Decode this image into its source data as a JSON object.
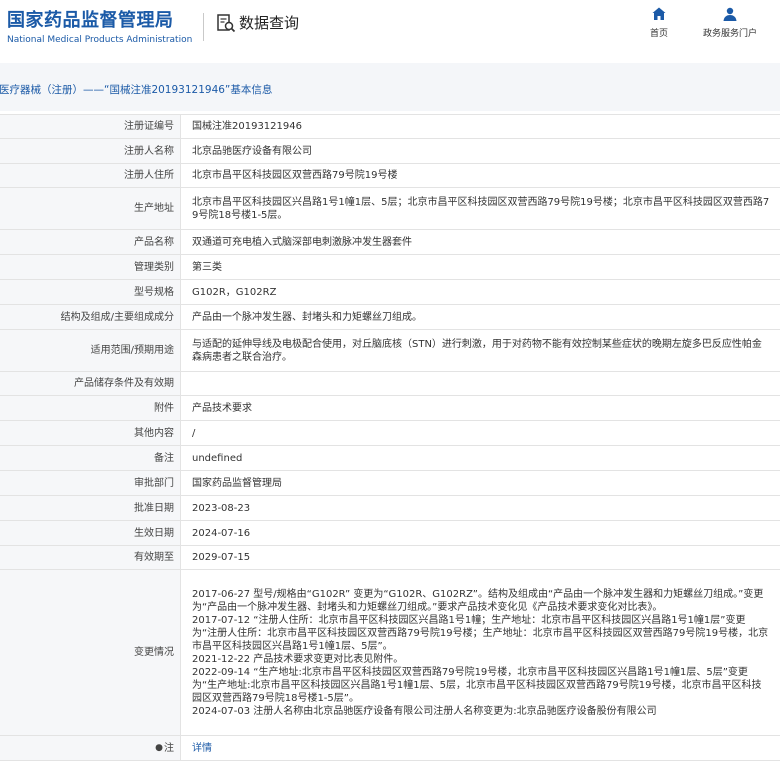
{
  "header": {
    "logo_cn": "国家药品监督管理局",
    "logo_en": "National Medical Products Administration",
    "section_title": "数据查询",
    "nav": [
      {
        "label": "首页",
        "icon": "home-icon"
      },
      {
        "label": "政务服务门户",
        "icon": "user-icon"
      }
    ]
  },
  "breadcrumb": "医疗器械（注册）——“国械注准20193121946”基本信息",
  "rows": [
    {
      "label": "注册证编号",
      "value": "国械注准20193121946"
    },
    {
      "label": "注册人名称",
      "value": "北京品驰医疗设备有限公司"
    },
    {
      "label": "注册人住所",
      "value": "北京市昌平区科技园区双营西路79号院19号楼"
    },
    {
      "label": "生产地址",
      "value": "北京市昌平区科技园区兴昌路1号1幢1层、5层；北京市昌平区科技园区双营西路79号院19号楼；北京市昌平区科技园区双营西路79号院18号楼1-5层。"
    },
    {
      "label": "产品名称",
      "value": "双通道可充电植入式脑深部电刺激脉冲发生器套件"
    },
    {
      "label": "管理类别",
      "value": "第三类"
    },
    {
      "label": "型号规格",
      "value": "G102R，G102RZ"
    },
    {
      "label": "结构及组成/主要组成成分",
      "value": "产品由一个脉冲发生器、封堵头和力矩螺丝刀组成。"
    },
    {
      "label": "适用范围/预期用途",
      "value": "与适配的延伸导线及电极配合使用，对丘脑底核（STN）进行刺激，用于对药物不能有效控制某些症状的晚期左旋多巴反应性帕金森病患者之联合治疗。"
    },
    {
      "label": "产品储存条件及有效期",
      "value": ""
    },
    {
      "label": "附件",
      "value": "产品技术要求"
    },
    {
      "label": "其他内容",
      "value": "/"
    },
    {
      "label": "备注",
      "value": "undefined"
    },
    {
      "label": "审批部门",
      "value": "国家药品监督管理局"
    },
    {
      "label": "批准日期",
      "value": "2023-08-23"
    },
    {
      "label": "生效日期",
      "value": "2024-07-16"
    },
    {
      "label": "有效期至",
      "value": "2029-07-15"
    }
  ],
  "changes": {
    "label": "变更情况",
    "items": [
      "2017-06-27 型号/规格由“G102R” 变更为“G102R、G102RZ”。结构及组成由“产品由一个脉冲发生器和力矩螺丝刀组成。”变更为“产品由一个脉冲发生器、封堵头和力矩螺丝刀组成。”要求产品技术变化见《产品技术要求变化对比表》。",
      "2017-07-12 “注册人住所：北京市昌平区科技园区兴昌路1号1幢；生产地址：北京市昌平区科技园区兴昌路1号1幢1层”变更为“注册人住所：北京市昌平区科技园区双营西路79号院19号楼；生产地址：北京市昌平区科技园区双营西路79号院19号楼，北京市昌平区科技园区兴昌路1号1幢1层、5层”。",
      "2021-12-22 产品技术要求变更对比表见附件。",
      "2022-09-14 “生产地址:北京市昌平区科技园区双营西路79号院19号楼，北京市昌平区科技园区兴昌路1号1幢1层、5层”变更为“生产地址:北京市昌平区科技园区兴昌路1号1幢1层、5层，北京市昌平区科技园区双营西路79号院19号楼，北京市昌平区科技园区双营西路79号院18号楼1-5层”。",
      "2024-07-03 注册人名称由北京品驰医疗设备有限公司注册人名称变更为:北京品驰医疗设备股份有限公司"
    ]
  },
  "note": {
    "label": "注",
    "value": "详情"
  }
}
